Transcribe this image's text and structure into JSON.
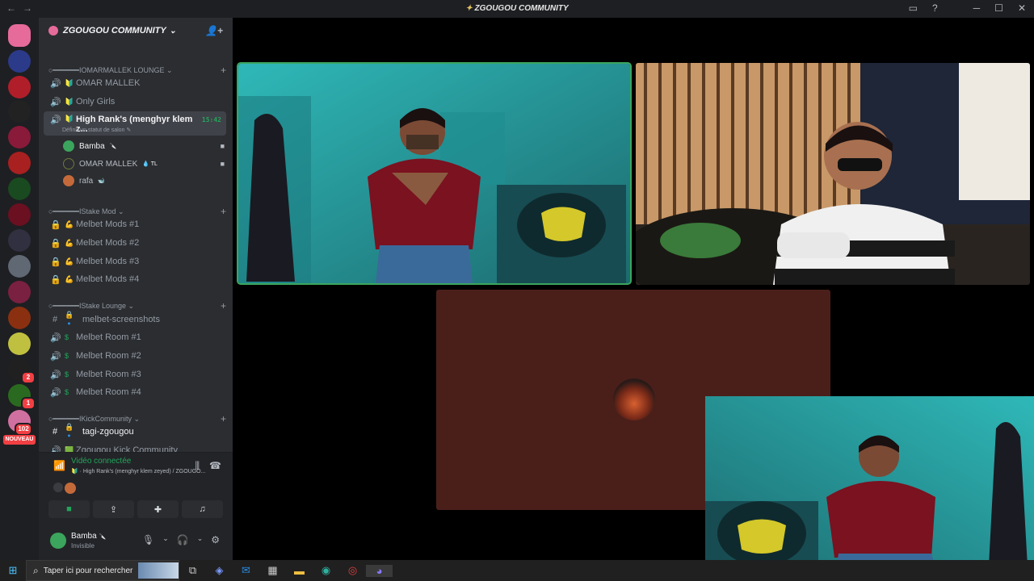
{
  "window": {
    "title": "ZGOUGOU COMMUNITY",
    "controls": [
      "─",
      "☐",
      "✕"
    ]
  },
  "server_list": {
    "nouveau_badge": "NOUVEAU",
    "badges": [
      "2",
      "1",
      "102"
    ]
  },
  "guild": {
    "name": "ZGOUGOU COMMUNITY"
  },
  "categories": [
    {
      "label": "○━━━━━━IOMARMALLEK LOUNGE ⌄"
    },
    {
      "label": "○━━━━━━IStake Mod ⌄"
    },
    {
      "label": "○━━━━━━IStake Lounge ⌄"
    },
    {
      "label": "○━━━━━━IKickCommunity ⌄"
    }
  ],
  "channels": [
    {
      "name": "OMAR MALLEK",
      "icon": "🔊",
      "emoji": "🔰"
    },
    {
      "name": "Only Girls",
      "icon": "🔊",
      "emoji": "🔰"
    },
    {
      "name": "High Rank's (menghyr klem z...",
      "icon": "🔊",
      "emoji": "🔰",
      "time": "15:42",
      "status": "Définir un statut de salon ✎"
    },
    {
      "name": "Melbet Mods #1",
      "icon": "🔒",
      "emoji": "💪"
    },
    {
      "name": "Melbet Mods #2",
      "icon": "🔒",
      "emoji": "💪"
    },
    {
      "name": "Melbet Mods #3",
      "icon": "🔒",
      "emoji": "💪"
    },
    {
      "name": "Melbet Mods #4",
      "icon": "🔒",
      "emoji": "💪"
    },
    {
      "name": "melbet-screenshots",
      "icon": "#",
      "emoji": "🔒🔹"
    },
    {
      "name": "Melbet Room #1",
      "icon": "🔊",
      "emoji": "$"
    },
    {
      "name": "Melbet Room #2",
      "icon": "🔊",
      "emoji": "$"
    },
    {
      "name": "Melbet Room #3",
      "icon": "🔊",
      "emoji": "$"
    },
    {
      "name": "Melbet Room #4",
      "icon": "🔊",
      "emoji": "$"
    },
    {
      "name": "tagi-zgougou",
      "icon": "#",
      "emoji": "🔒🔹"
    },
    {
      "name": "Zgougou Kick Community",
      "icon": "🔊",
      "emoji": "🟩"
    }
  ],
  "voice_users": [
    {
      "name": "Bamba",
      "suffix": "🔪",
      "color": "#3ba55d"
    },
    {
      "name": "OMAR MALLEK",
      "suffix": "💧 TL",
      "color": "#6b7a3a"
    },
    {
      "name": "rafa",
      "suffix": "🐋",
      "color": "#c46a3a"
    }
  ],
  "voice_panel": {
    "status": "Vidéo connectée",
    "subtitle": "🔰 · High Rank's (menghyr klem zeyed) / ZGOUGO..."
  },
  "user_panel": {
    "name": "Bamba",
    "name_suffix": "🔪",
    "status": "Invisible"
  },
  "taskbar": {
    "search_placeholder": "Taper ici pour rechercher"
  },
  "colors": {
    "speaking_outline": "#3ba55d",
    "sidebar_bg": "#2b2d31",
    "server_bg": "#1e1f22",
    "placeholder_tile": "#4a1f1a"
  }
}
